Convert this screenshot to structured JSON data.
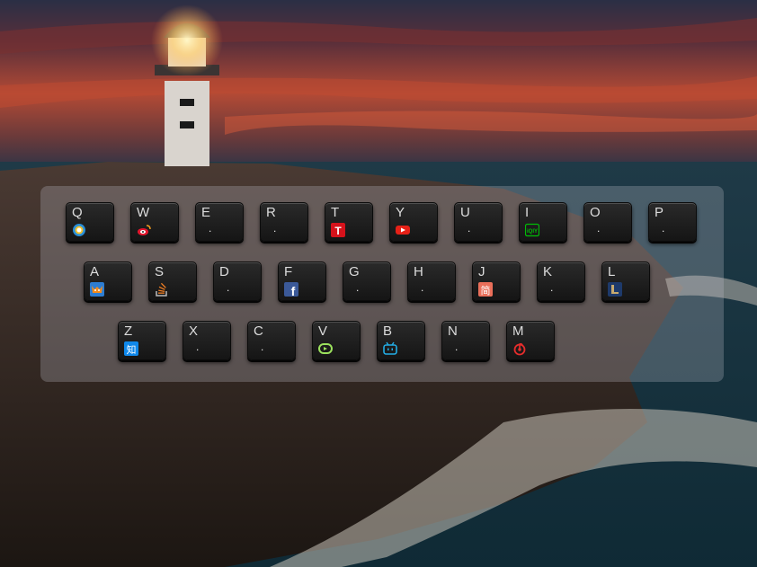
{
  "keyboard": {
    "rows": [
      [
        {
          "letter": "Q",
          "icon": "browser-icon"
        },
        {
          "letter": "W",
          "icon": "weibo-icon"
        },
        {
          "letter": "E",
          "icon": "",
          "placeholder": "."
        },
        {
          "letter": "R",
          "icon": "",
          "placeholder": "."
        },
        {
          "letter": "T",
          "icon": "t-red-icon"
        },
        {
          "letter": "Y",
          "icon": "youtube-icon"
        },
        {
          "letter": "U",
          "icon": "",
          "placeholder": "."
        },
        {
          "letter": "I",
          "icon": "iqiyi-icon"
        },
        {
          "letter": "O",
          "icon": "",
          "placeholder": "."
        },
        {
          "letter": "P",
          "icon": "",
          "placeholder": "."
        }
      ],
      [
        {
          "letter": "A",
          "icon": "fox-icon"
        },
        {
          "letter": "S",
          "icon": "stackoverflow-icon"
        },
        {
          "letter": "D",
          "icon": "",
          "placeholder": "."
        },
        {
          "letter": "F",
          "icon": "facebook-icon"
        },
        {
          "letter": "G",
          "icon": "",
          "placeholder": "."
        },
        {
          "letter": "H",
          "icon": "",
          "placeholder": "."
        },
        {
          "letter": "J",
          "icon": "jianshu-icon"
        },
        {
          "letter": "K",
          "icon": "",
          "placeholder": "."
        },
        {
          "letter": "L",
          "icon": "league-icon"
        }
      ],
      [
        {
          "letter": "Z",
          "icon": "zhihu-icon"
        },
        {
          "letter": "X",
          "icon": "",
          "placeholder": "."
        },
        {
          "letter": "C",
          "icon": "",
          "placeholder": "."
        },
        {
          "letter": "V",
          "icon": "vplay-icon"
        },
        {
          "letter": "B",
          "icon": "bilibili-icon"
        },
        {
          "letter": "N",
          "icon": "",
          "placeholder": "."
        },
        {
          "letter": "M",
          "icon": "netease-music-icon"
        }
      ]
    ]
  },
  "icon_glyphs": {
    "t-red-icon": "T",
    "iqiyi-icon": "iQIY",
    "jianshu-icon": "简",
    "zhihu-icon": "知",
    "facebook-icon": "f"
  },
  "colors": {
    "key_text": "#dcdcdc",
    "panel": "rgba(190,190,200,0.28)"
  }
}
